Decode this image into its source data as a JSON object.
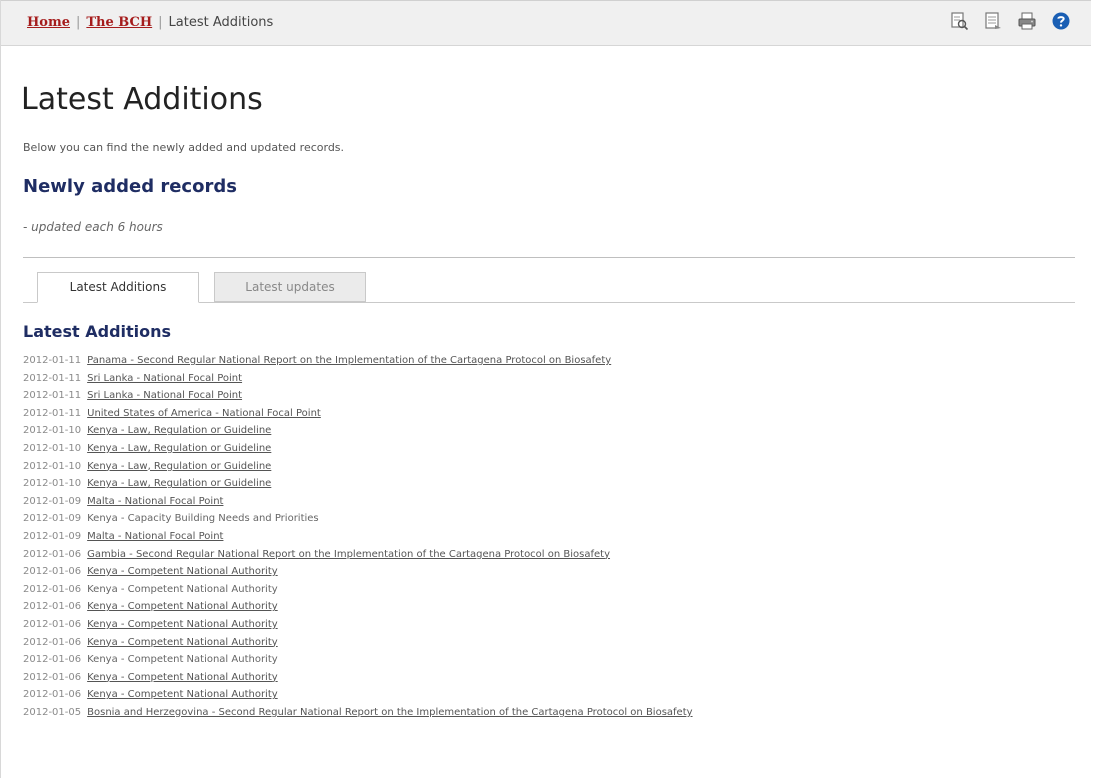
{
  "breadcrumb": {
    "home": "Home",
    "sep1": "|",
    "bch": "The BCH",
    "sep2": "|",
    "current": "Latest Additions"
  },
  "toolbar": {
    "icons": [
      "print-preview-icon",
      "document-icon",
      "print-icon",
      "help-icon"
    ],
    "accent": "#1a5fb4"
  },
  "page": {
    "title": "Latest Additions",
    "intro": "Below you can find the newly added and updated records.",
    "subheading": "Newly added records",
    "note": "- updated each 6 hours"
  },
  "tabs": {
    "active": "Latest Additions",
    "inactive": "Latest updates"
  },
  "list": {
    "title": "Latest Additions",
    "items": [
      {
        "date": "2012-01-11",
        "text": "Panama - Second Regular National Report on the Implementation of the Cartagena Protocol on Biosafety",
        "link": true
      },
      {
        "date": "2012-01-11",
        "text": "Sri Lanka - National Focal Point",
        "link": true
      },
      {
        "date": "2012-01-11",
        "text": "Sri Lanka - National Focal Point",
        "link": true
      },
      {
        "date": "2012-01-11",
        "text": "United States of America - National Focal Point",
        "link": true
      },
      {
        "date": "2012-01-10",
        "text": "Kenya - Law, Regulation or Guideline",
        "link": true
      },
      {
        "date": "2012-01-10",
        "text": "Kenya - Law, Regulation or Guideline",
        "link": true
      },
      {
        "date": "2012-01-10",
        "text": "Kenya - Law, Regulation or Guideline",
        "link": true
      },
      {
        "date": "2012-01-10",
        "text": "Kenya - Law, Regulation or Guideline",
        "link": true
      },
      {
        "date": "2012-01-09",
        "text": "Malta - National Focal Point",
        "link": true
      },
      {
        "date": "2012-01-09",
        "text": "Kenya - Capacity Building Needs and Priorities",
        "link": false
      },
      {
        "date": "2012-01-09",
        "text": "Malta - National Focal Point",
        "link": true
      },
      {
        "date": "2012-01-06",
        "text": "Gambia - Second Regular National Report on the Implementation of the Cartagena Protocol on Biosafety",
        "link": true
      },
      {
        "date": "2012-01-06",
        "text": "Kenya - Competent National Authority",
        "link": true
      },
      {
        "date": "2012-01-06",
        "text": "Kenya - Competent National Authority",
        "link": false
      },
      {
        "date": "2012-01-06",
        "text": "Kenya - Competent National Authority",
        "link": true
      },
      {
        "date": "2012-01-06",
        "text": "Kenya - Competent National Authority",
        "link": true
      },
      {
        "date": "2012-01-06",
        "text": "Kenya - Competent National Authority",
        "link": true
      },
      {
        "date": "2012-01-06",
        "text": "Kenya - Competent National Authority",
        "link": false
      },
      {
        "date": "2012-01-06",
        "text": "Kenya - Competent National Authority",
        "link": true
      },
      {
        "date": "2012-01-06",
        "text": "Kenya - Competent National Authority",
        "link": true
      },
      {
        "date": "2012-01-05",
        "text": "Bosnia and Herzegovina - Second Regular National Report on the Implementation of the Cartagena Protocol on Biosafety",
        "link": true
      }
    ]
  }
}
